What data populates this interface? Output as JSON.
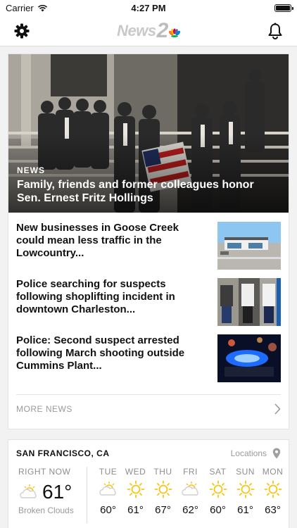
{
  "status": {
    "carrier": "Carrier",
    "time": "4:27 PM",
    "battery_level": 1.0
  },
  "header": {
    "logo_text": "News",
    "logo_number": "2",
    "settings_icon": "gear-icon",
    "notifications_icon": "bell-icon"
  },
  "hero": {
    "category": "NEWS",
    "title": "Family, friends and former colleagues honor Sen. Ernest Fritz Hollings"
  },
  "stories": [
    {
      "title": "New businesses in Goose Creek could mean less traffic in the Lowcountry..."
    },
    {
      "title": "Police searching for suspects following shoplifting incident in downtown Charleston..."
    },
    {
      "title": "Police: Second suspect arrested following March shooting outside Cummins Plant..."
    }
  ],
  "more_news": {
    "label": "MORE NEWS"
  },
  "weather": {
    "location": "SAN FRANCISCO, CA",
    "locations_label": "Locations",
    "current": {
      "label": "RIGHT NOW",
      "temp": "61°",
      "condition": "Broken Clouds",
      "icon": "partly-cloudy-icon"
    },
    "forecast": [
      {
        "day": "TUE",
        "temp": "60°",
        "icon": "partly-cloudy-icon"
      },
      {
        "day": "WED",
        "temp": "61°",
        "icon": "sun-icon"
      },
      {
        "day": "THU",
        "temp": "67°",
        "icon": "sun-icon"
      },
      {
        "day": "FRI",
        "temp": "62°",
        "icon": "partly-cloudy-icon"
      },
      {
        "day": "SAT",
        "temp": "60°",
        "icon": "sun-icon"
      },
      {
        "day": "SUN",
        "temp": "61°",
        "icon": "sun-icon"
      },
      {
        "day": "MON",
        "temp": "63°",
        "icon": "sun-icon"
      }
    ]
  },
  "colors": {
    "sun": "#f5c518",
    "cloud": "#cfcfcf",
    "muted_text": "#9a9a9a"
  }
}
